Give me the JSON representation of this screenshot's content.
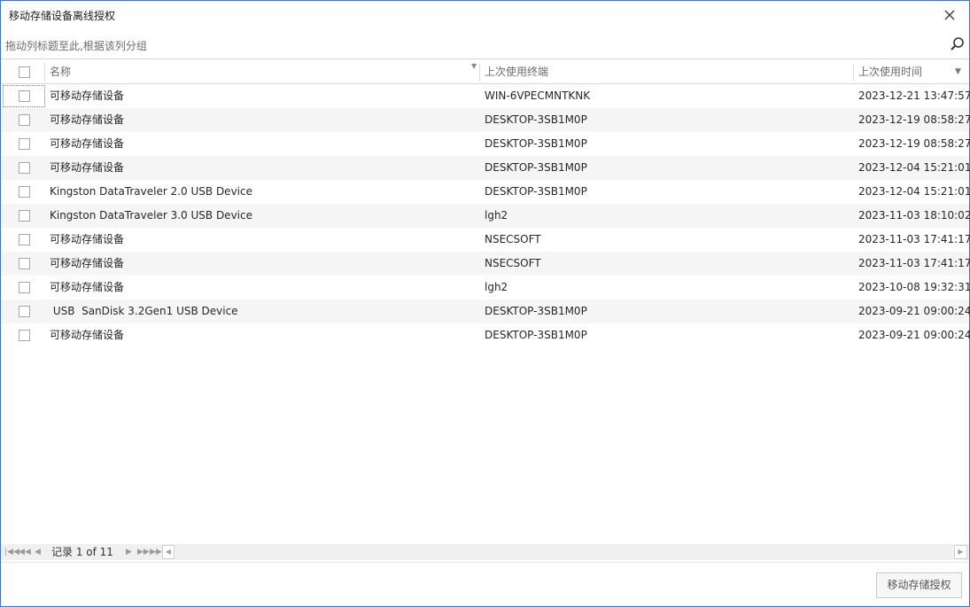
{
  "window": {
    "title": "移动存储设备离线授权"
  },
  "group_panel": {
    "hint": "拖动列标题至此,根据该列分组"
  },
  "columns": {
    "name": "名称",
    "terminal": "上次使用终端",
    "time": "上次使用时间"
  },
  "rows": [
    {
      "name": "可移动存储设备",
      "terminal": "WIN-6VPECMNTKNK",
      "time": "2023-12-21 13:47:57"
    },
    {
      "name": "可移动存储设备",
      "terminal": "DESKTOP-3SB1M0P",
      "time": "2023-12-19 08:58:27"
    },
    {
      "name": "可移动存储设备",
      "terminal": "DESKTOP-3SB1M0P",
      "time": "2023-12-19 08:58:27"
    },
    {
      "name": "可移动存储设备",
      "terminal": "DESKTOP-3SB1M0P",
      "time": "2023-12-04 15:21:01"
    },
    {
      "name": "Kingston DataTraveler 2.0 USB Device",
      "terminal": "DESKTOP-3SB1M0P",
      "time": "2023-12-04 15:21:01"
    },
    {
      "name": "Kingston DataTraveler 3.0 USB Device",
      "terminal": "lgh2",
      "time": "2023-11-03 18:10:02"
    },
    {
      "name": "可移动存储设备",
      "terminal": "NSECSOFT",
      "time": "2023-11-03 17:41:17"
    },
    {
      "name": "可移动存储设备",
      "terminal": "NSECSOFT",
      "time": "2023-11-03 17:41:17"
    },
    {
      "name": "可移动存储设备",
      "terminal": "lgh2",
      "time": "2023-10-08 19:32:31"
    },
    {
      "name": " USB  SanDisk 3.2Gen1 USB Device",
      "terminal": "DESKTOP-3SB1M0P",
      "time": "2023-09-21 09:00:24"
    },
    {
      "name": "可移动存储设备",
      "terminal": "DESKTOP-3SB1M0P",
      "time": "2023-09-21 09:00:24"
    }
  ],
  "pager": {
    "record_text": "记录 1 of 11",
    "first_icon": "first-page-icon",
    "prev_page_icon": "prev-page-icon",
    "prev_icon": "prev-icon",
    "next_icon": "next-icon",
    "next_page_icon": "next-page-icon",
    "last_icon": "last-page-icon"
  },
  "footer": {
    "authorize_button": "移动存储授权"
  },
  "colors": {
    "window_border": "#2b7bd4",
    "alt_row": "#f5f5f5",
    "header_text": "#6b6b6b"
  }
}
